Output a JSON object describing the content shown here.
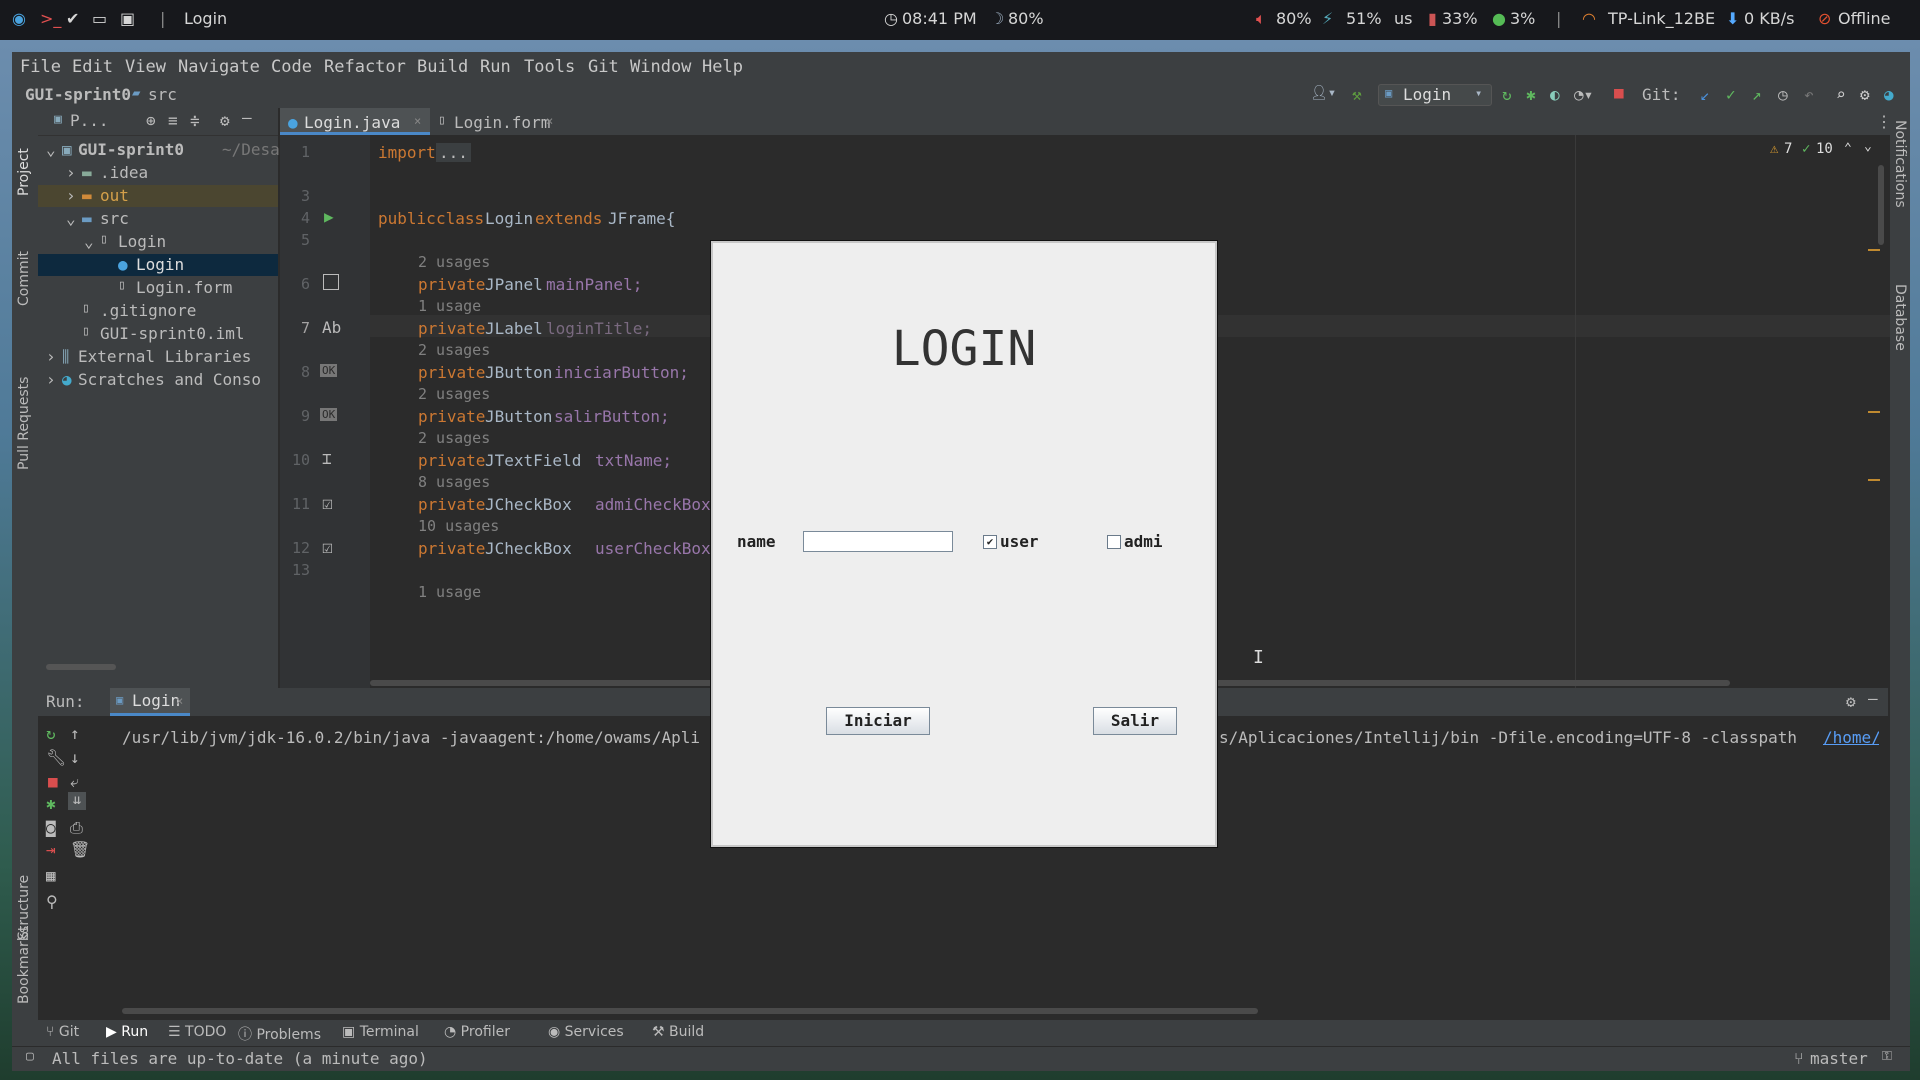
{
  "system_bar": {
    "window_title": "Login",
    "time": "08:41 PM",
    "moon": "80%",
    "volume": "80%",
    "cpu": "51%",
    "layout": "us",
    "memory": "33%",
    "disk": "3%",
    "wifi": "TP-Link_12BE",
    "net_speed": "0 KB/s",
    "status": "Offline"
  },
  "menu": [
    "File",
    "Edit",
    "View",
    "Navigate",
    "Code",
    "Refactor",
    "Build",
    "Run",
    "Tools",
    "Git",
    "Window",
    "Help"
  ],
  "breadcrumb": {
    "project": "GUI-sprint0",
    "folder": "src"
  },
  "toolbar": {
    "run_config": "Login",
    "git_label": "Git:"
  },
  "project_panel": {
    "title": "P...",
    "root": "GUI-sprint0",
    "root_path": "~/Desa",
    "items": [
      ".idea",
      "out",
      "src",
      "Login",
      "Login",
      "Login.form",
      ".gitignore",
      "GUI-sprint0.iml",
      "External Libraries",
      "Scratches and Conso"
    ]
  },
  "side_tabs": {
    "project": "Project",
    "commit": "Commit",
    "pull_requests": "Pull Requests",
    "structure": "Structure",
    "bookmarks": "Bookmarks",
    "notifications": "Notifications",
    "database": "Database"
  },
  "editor_tabs": [
    {
      "label": "Login.java"
    },
    {
      "label": "Login.form"
    }
  ],
  "inspections": {
    "warnings": "7",
    "ok": "10"
  },
  "code": {
    "line_numbers": [
      "1",
      "3",
      "4",
      "5",
      "6",
      "7",
      "8",
      "9",
      "10",
      "11",
      "12",
      "13"
    ],
    "import_kw": "import",
    "import_fold": "...",
    "class_line": {
      "kw1": "public",
      "kw2": "class",
      "name": "Login",
      "kw3": "extends",
      "parent": "JFrame{"
    },
    "hints": [
      "2 usages",
      "1 usage",
      "2 usages",
      "2 usages",
      "2 usages",
      "8 usages",
      "10 usages",
      "1 usage"
    ],
    "fields": [
      {
        "type": "JPanel",
        "name": "mainPanel;"
      },
      {
        "type": "JLabel",
        "name": "loginTitle;"
      },
      {
        "type": "JButton",
        "name": "iniciarButton;"
      },
      {
        "type": "JButton",
        "name": "salirButton;"
      },
      {
        "type": "JTextField",
        "name": "txtName;"
      },
      {
        "type": "JCheckBox",
        "name": "admiCheckBox;"
      },
      {
        "type": "JCheckBox",
        "name": "userCheckBox;"
      }
    ],
    "private_kw": "private",
    "gutter_icons": [
      "Ab",
      "OK",
      "OK"
    ]
  },
  "run_panel": {
    "label": "Run:",
    "tab": "Login",
    "command_left": "/usr/lib/jvm/jdk-16.0.2/bin/java -javaagent:/home/owams/Apli",
    "command_right": "s/Aplicaciones/Intellij/bin -Dfile.encoding=UTF-8 -classpath",
    "command_link": "/home/o"
  },
  "bottom_tabs": [
    "Git",
    "Run",
    "TODO",
    "Problems",
    "Terminal",
    "Profiler",
    "Services",
    "Build"
  ],
  "status": {
    "message": "All files are up-to-date (a minute ago)",
    "branch": "master"
  },
  "dialog": {
    "title": "LOGIN",
    "name_label": "name",
    "name_value": "",
    "user_label": "user",
    "user_checked": true,
    "admin_label": "admi",
    "admin_checked": false,
    "start_button": "Iniciar",
    "exit_button": "Salir"
  }
}
